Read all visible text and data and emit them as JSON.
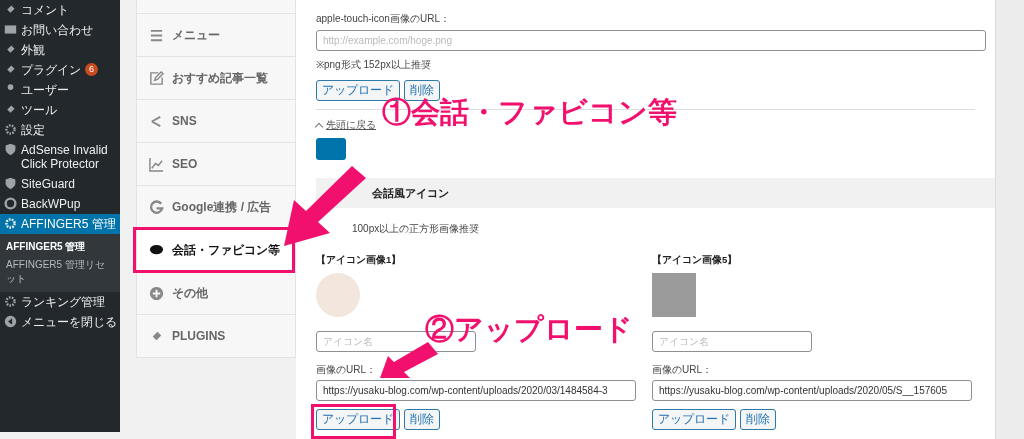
{
  "sidebar": {
    "items": [
      {
        "label": "コメント",
        "selected": false
      },
      {
        "label": "お問い合わせ",
        "selected": false
      },
      {
        "label": "外観",
        "selected": false
      },
      {
        "label": "プラグイン",
        "badge": "6",
        "selected": false
      },
      {
        "label": "ユーザー",
        "selected": false
      },
      {
        "label": "ツール",
        "selected": false
      },
      {
        "label": "設定",
        "selected": false
      },
      {
        "label": "AdSense Invalid Click Protector",
        "selected": false
      },
      {
        "label": "SiteGuard",
        "selected": false
      },
      {
        "label": "BackWPup",
        "selected": false
      },
      {
        "label": "AFFINGER5 管理",
        "selected": true,
        "children": [
          {
            "label": "AFFINGER5 管理",
            "selected": true
          },
          {
            "label": "AFFINGER5 管理リセット",
            "selected": false
          }
        ]
      },
      {
        "label": "ランキング管理",
        "selected": false
      },
      {
        "label": "メニューを閉じる",
        "selected": false
      }
    ]
  },
  "tabs": [
    {
      "label": "メニュー",
      "selected": false
    },
    {
      "label": "おすすめ記事一覧",
      "selected": false
    },
    {
      "label": "SNS",
      "selected": false
    },
    {
      "label": "SEO",
      "selected": false
    },
    {
      "label": "Google連携 / 広告",
      "selected": false
    },
    {
      "label": "会話・ファビコン等",
      "selected": true
    },
    {
      "label": "その他",
      "selected": false
    },
    {
      "label": "PLUGINS",
      "selected": false
    }
  ],
  "content": {
    "apple_touch_icon": {
      "label": "apple-touch-icon画像のURL：",
      "placeholder": "http://example.com/hoge.png",
      "note": "※png形式 152px以上推奨",
      "buttons": [
        "アップロード",
        "削除"
      ]
    },
    "back_link": "先頭に戻る",
    "section_title": "会話風アイコン",
    "section_note": "100px以上の正方形画像推奨",
    "icons": [
      {
        "label": "【アイコン画像1】",
        "name_placeholder": "アイコン名",
        "url_label": "画像のURL：",
        "url": "https://yusaku-blog.com/wp-content/uploads/2020/03/1484584-3",
        "buttons": [
          "アップロード",
          "削除"
        ]
      },
      {
        "label": "【アイコン画像5】",
        "name_placeholder": "アイコン名",
        "url_label": "画像のURL：",
        "url": "https://yusaku-blog.com/wp-content/uploads/2020/05/S__157605",
        "buttons": [
          "アップロード",
          "削除"
        ]
      }
    ]
  },
  "annotations": [
    "①会話・ファビコン等",
    "②アップロード"
  ]
}
